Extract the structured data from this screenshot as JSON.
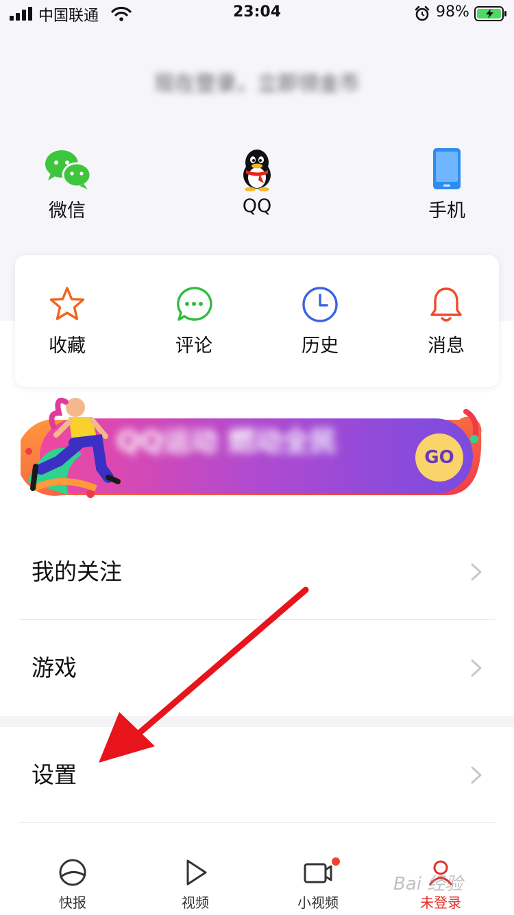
{
  "status_bar": {
    "carrier": "中国联通",
    "time": "23:04",
    "battery": "98%"
  },
  "login": {
    "prompt": "现在登录，立即领金币",
    "options": [
      {
        "label": "微信",
        "icon": "wechat-icon"
      },
      {
        "label": "QQ",
        "icon": "qq-icon"
      },
      {
        "label": "手机",
        "icon": "phone-icon"
      }
    ]
  },
  "quick_actions": [
    {
      "label": "收藏",
      "icon": "star-icon",
      "color": "#f0641e"
    },
    {
      "label": "评论",
      "icon": "comment-icon",
      "color": "#2ebd3c"
    },
    {
      "label": "历史",
      "icon": "clock-icon",
      "color": "#3a62e8"
    },
    {
      "label": "消息",
      "icon": "bell-icon",
      "color": "#f04a2a"
    }
  ],
  "banner": {
    "text": "QQ运动 燃动全民",
    "button": "GO"
  },
  "menu": [
    {
      "label": "我的关注",
      "icon": "chevron-right-icon"
    },
    {
      "label": "游戏",
      "icon": "chevron-right-icon"
    },
    {
      "label": "设置",
      "icon": "chevron-right-icon"
    }
  ],
  "bottom_nav": [
    {
      "label": "快报",
      "icon": "news-icon"
    },
    {
      "label": "视频",
      "icon": "play-icon"
    },
    {
      "label": "小视频",
      "icon": "camera-icon"
    },
    {
      "label": "未登录",
      "icon": "user-icon",
      "active": true
    }
  ],
  "watermark": "Bai 经验",
  "colors": {
    "accent_red": "#e0302a",
    "banner_gradient_start": "#f048a0",
    "banner_gradient_end": "#7a4be0",
    "go_button": "#f8d46b"
  }
}
